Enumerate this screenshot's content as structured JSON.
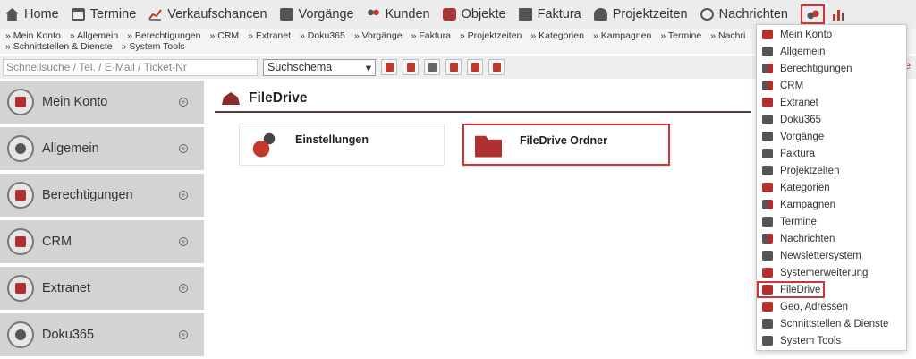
{
  "topnav": {
    "items": [
      {
        "label": "Home",
        "icon": "home-icon"
      },
      {
        "label": "Termine",
        "icon": "calendar-icon"
      },
      {
        "label": "Verkaufschancen",
        "icon": "line-chart-icon"
      },
      {
        "label": "Vorgänge",
        "icon": "clipboard-icon"
      },
      {
        "label": "Kunden",
        "icon": "users-icon"
      },
      {
        "label": "Objekte",
        "icon": "objects-icon"
      },
      {
        "label": "Faktura",
        "icon": "invoice-icon"
      },
      {
        "label": "Projektzeiten",
        "icon": "project-time-icon"
      },
      {
        "label": "Nachrichten",
        "icon": "messages-icon"
      }
    ],
    "settings_icon": "gears-icon",
    "reports_icon": "bar-chart-icon"
  },
  "linkbar": {
    "row1": [
      "» Mein Konto",
      "» Allgemein",
      "» Berechtigungen",
      "» CRM",
      "» Extranet",
      "» Doku365",
      "» Vorgänge",
      "» Faktura",
      "» Projektzeiten",
      "» Kategorien",
      "» Kampagnen",
      "» Termine",
      "» Nachri"
    ],
    "row2": [
      "» Schnittstellen & Dienste",
      "» System Tools"
    ]
  },
  "search": {
    "placeholder": "Schnellsuche / Tel. / E-Mail / Ticket-Nr",
    "schema_value": "Suchschema",
    "right_edge_text": "rte"
  },
  "sidebar": {
    "items": [
      {
        "label": "Mein Konto"
      },
      {
        "label": "Allgemein"
      },
      {
        "label": "Berechtigungen"
      },
      {
        "label": "CRM"
      },
      {
        "label": "Extranet"
      },
      {
        "label": "Doku365"
      }
    ]
  },
  "main": {
    "title": "FileDrive",
    "cards": [
      {
        "label": "Einstellungen",
        "icon": "cloud-settings-icon"
      },
      {
        "label": "FileDrive Ordner",
        "icon": "folder-cloud-icon"
      }
    ]
  },
  "dropdown": {
    "items": [
      "Mein Konto",
      "Allgemein",
      "Berechtigungen",
      "CRM",
      "Extranet",
      "Doku365",
      "Vorgänge",
      "Faktura",
      "Projektzeiten",
      "Kategorien",
      "Kampagnen",
      "Termine",
      "Nachrichten",
      "Newslettersystem",
      "Systemerweiterung",
      "FileDrive",
      "Geo, Adressen",
      "Schnittstellen & Dienste",
      "System Tools"
    ],
    "selected": "FileDrive"
  },
  "colors": {
    "accent": "#d13438",
    "brand_dark": "#8a2c2c"
  }
}
